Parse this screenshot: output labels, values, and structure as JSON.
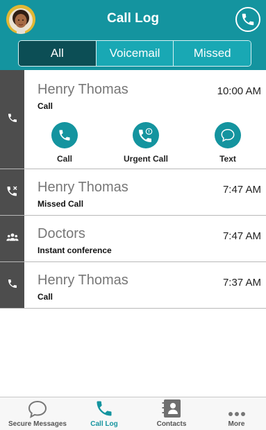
{
  "header": {
    "title": "Call Log",
    "avatar_icon": "user-avatar",
    "call_icon": "phone-icon"
  },
  "tabs": [
    {
      "label": "All",
      "active": true
    },
    {
      "label": "Voicemail",
      "active": false
    },
    {
      "label": "Missed",
      "active": false
    }
  ],
  "entries": [
    {
      "name": "Henry Thomas",
      "detail": "Call",
      "time": "10:00 AM",
      "icon": "phone-icon",
      "expanded": true
    },
    {
      "name": "Henry Thomas",
      "detail": "Missed Call",
      "time": "7:47 AM",
      "icon": "missed-call-icon"
    },
    {
      "name": "Doctors",
      "detail": "Instant conference",
      "time": "7:47 AM",
      "icon": "conference-icon"
    },
    {
      "name": "Henry Thomas",
      "detail": "Call",
      "time": "7:37 AM",
      "icon": "phone-icon"
    }
  ],
  "actions": {
    "call": "Call",
    "urgent": "Urgent Call",
    "text": "Text"
  },
  "bottom_nav": [
    {
      "label": "Secure Messages",
      "icon": "chat-bubble-icon",
      "active": false
    },
    {
      "label": "Call Log",
      "icon": "phone-icon",
      "active": true
    },
    {
      "label": "Contacts",
      "icon": "contacts-book-icon",
      "active": false
    },
    {
      "label": "More",
      "icon": "more-dots-icon",
      "active": false
    }
  ],
  "colors": {
    "primary": "#14949f",
    "tab_active": "#0c4e55",
    "tab_inactive": "#19a8b4",
    "strip": "#4d4d4d"
  }
}
